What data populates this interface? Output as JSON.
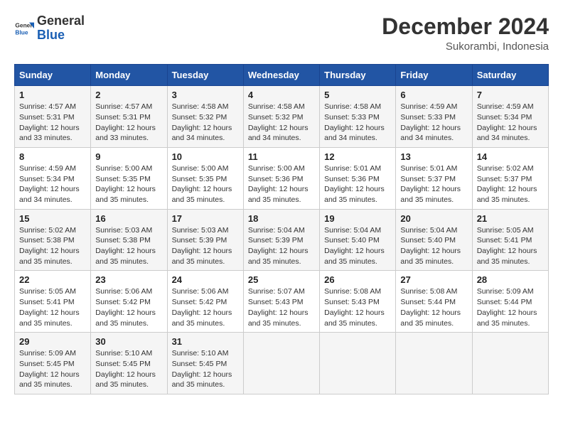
{
  "logo": {
    "text_general": "General",
    "text_blue": "Blue"
  },
  "title": "December 2024",
  "location": "Sukorambi, Indonesia",
  "days_of_week": [
    "Sunday",
    "Monday",
    "Tuesday",
    "Wednesday",
    "Thursday",
    "Friday",
    "Saturday"
  ],
  "weeks": [
    [
      {
        "day": "1",
        "sunrise": "4:57 AM",
        "sunset": "5:31 PM",
        "daylight": "12 hours and 33 minutes."
      },
      {
        "day": "2",
        "sunrise": "4:57 AM",
        "sunset": "5:31 PM",
        "daylight": "12 hours and 33 minutes."
      },
      {
        "day": "3",
        "sunrise": "4:58 AM",
        "sunset": "5:32 PM",
        "daylight": "12 hours and 34 minutes."
      },
      {
        "day": "4",
        "sunrise": "4:58 AM",
        "sunset": "5:32 PM",
        "daylight": "12 hours and 34 minutes."
      },
      {
        "day": "5",
        "sunrise": "4:58 AM",
        "sunset": "5:33 PM",
        "daylight": "12 hours and 34 minutes."
      },
      {
        "day": "6",
        "sunrise": "4:59 AM",
        "sunset": "5:33 PM",
        "daylight": "12 hours and 34 minutes."
      },
      {
        "day": "7",
        "sunrise": "4:59 AM",
        "sunset": "5:34 PM",
        "daylight": "12 hours and 34 minutes."
      }
    ],
    [
      {
        "day": "8",
        "sunrise": "4:59 AM",
        "sunset": "5:34 PM",
        "daylight": "12 hours and 34 minutes."
      },
      {
        "day": "9",
        "sunrise": "5:00 AM",
        "sunset": "5:35 PM",
        "daylight": "12 hours and 35 minutes."
      },
      {
        "day": "10",
        "sunrise": "5:00 AM",
        "sunset": "5:35 PM",
        "daylight": "12 hours and 35 minutes."
      },
      {
        "day": "11",
        "sunrise": "5:00 AM",
        "sunset": "5:36 PM",
        "daylight": "12 hours and 35 minutes."
      },
      {
        "day": "12",
        "sunrise": "5:01 AM",
        "sunset": "5:36 PM",
        "daylight": "12 hours and 35 minutes."
      },
      {
        "day": "13",
        "sunrise": "5:01 AM",
        "sunset": "5:37 PM",
        "daylight": "12 hours and 35 minutes."
      },
      {
        "day": "14",
        "sunrise": "5:02 AM",
        "sunset": "5:37 PM",
        "daylight": "12 hours and 35 minutes."
      }
    ],
    [
      {
        "day": "15",
        "sunrise": "5:02 AM",
        "sunset": "5:38 PM",
        "daylight": "12 hours and 35 minutes."
      },
      {
        "day": "16",
        "sunrise": "5:03 AM",
        "sunset": "5:38 PM",
        "daylight": "12 hours and 35 minutes."
      },
      {
        "day": "17",
        "sunrise": "5:03 AM",
        "sunset": "5:39 PM",
        "daylight": "12 hours and 35 minutes."
      },
      {
        "day": "18",
        "sunrise": "5:04 AM",
        "sunset": "5:39 PM",
        "daylight": "12 hours and 35 minutes."
      },
      {
        "day": "19",
        "sunrise": "5:04 AM",
        "sunset": "5:40 PM",
        "daylight": "12 hours and 35 minutes."
      },
      {
        "day": "20",
        "sunrise": "5:04 AM",
        "sunset": "5:40 PM",
        "daylight": "12 hours and 35 minutes."
      },
      {
        "day": "21",
        "sunrise": "5:05 AM",
        "sunset": "5:41 PM",
        "daylight": "12 hours and 35 minutes."
      }
    ],
    [
      {
        "day": "22",
        "sunrise": "5:05 AM",
        "sunset": "5:41 PM",
        "daylight": "12 hours and 35 minutes."
      },
      {
        "day": "23",
        "sunrise": "5:06 AM",
        "sunset": "5:42 PM",
        "daylight": "12 hours and 35 minutes."
      },
      {
        "day": "24",
        "sunrise": "5:06 AM",
        "sunset": "5:42 PM",
        "daylight": "12 hours and 35 minutes."
      },
      {
        "day": "25",
        "sunrise": "5:07 AM",
        "sunset": "5:43 PM",
        "daylight": "12 hours and 35 minutes."
      },
      {
        "day": "26",
        "sunrise": "5:08 AM",
        "sunset": "5:43 PM",
        "daylight": "12 hours and 35 minutes."
      },
      {
        "day": "27",
        "sunrise": "5:08 AM",
        "sunset": "5:44 PM",
        "daylight": "12 hours and 35 minutes."
      },
      {
        "day": "28",
        "sunrise": "5:09 AM",
        "sunset": "5:44 PM",
        "daylight": "12 hours and 35 minutes."
      }
    ],
    [
      {
        "day": "29",
        "sunrise": "5:09 AM",
        "sunset": "5:45 PM",
        "daylight": "12 hours and 35 minutes."
      },
      {
        "day": "30",
        "sunrise": "5:10 AM",
        "sunset": "5:45 PM",
        "daylight": "12 hours and 35 minutes."
      },
      {
        "day": "31",
        "sunrise": "5:10 AM",
        "sunset": "5:45 PM",
        "daylight": "12 hours and 35 minutes."
      },
      null,
      null,
      null,
      null
    ]
  ]
}
